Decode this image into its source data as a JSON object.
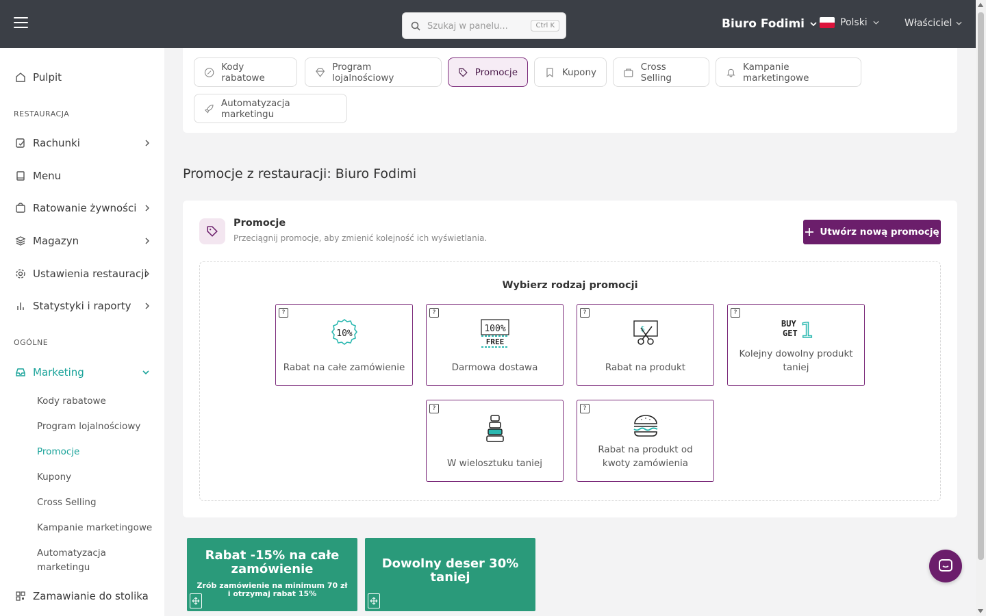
{
  "topbar": {
    "search_placeholder": "Szukaj w panelu...",
    "search_shortcut": "Ctrl K",
    "restaurant": "Biuro Fodimi",
    "language": "Polski",
    "role": "Właściciel"
  },
  "sidebar": {
    "dashboard": "Pulpit",
    "section_restaurant": "RESTAURACJA",
    "bills": "Rachunki",
    "menu": "Menu",
    "food_rescue": "Ratowanie żywności",
    "warehouse": "Magazyn",
    "settings": "Ustawienia restauracji",
    "stats": "Statystyki i raporty",
    "section_general": "OGÓLNE",
    "marketing": "Marketing",
    "sub": [
      "Kody rabatowe",
      "Program lojalnościowy",
      "Promocje",
      "Kupony",
      "Cross Selling",
      "Kampanie marketingowe",
      "Automatyzacja marketingu"
    ],
    "table_ordering": "Zamawianie do stolika"
  },
  "tabs": [
    "Kody rabatowe",
    "Program lojalnościowy",
    "Promocje",
    "Kupony",
    "Cross Selling",
    "Kampanie marketingowe",
    "Automatyzacja marketingu"
  ],
  "page_title": "Promocje z restauracji: Biuro Fodimi",
  "card": {
    "title": "Promocje",
    "subtitle": "Przeciągnij promocje, aby zmienić kolejność ich wyświetlania.",
    "create_button": "Utwórz nową promocję",
    "choose_title": "Wybierz rodzaj promocji",
    "help_glyph": "?",
    "types": [
      "Rabat na całe zamówienie",
      "Darmowa dostawa",
      "Rabat na produkt",
      "Kolejny dowolny produkt taniej",
      "W wielosztuku taniej",
      "Rabat na produkt od kwoty zamówienia"
    ],
    "icon_text": {
      "percent": "10%",
      "free_top": "100%",
      "free_bottom": "FREE",
      "buy": "BUY",
      "get": "GET",
      "one": "1"
    }
  },
  "promos": [
    {
      "title": "Rabat -15% na całe zamówienie",
      "desc": "Zrób zamówienie na minimum 70 zł i otrzymaj rabat 15%"
    },
    {
      "title": "Dowolny deser 30% taniej",
      "desc": ""
    }
  ],
  "colors": {
    "accent": "#6b1e6b",
    "teal": "#1aa39a",
    "promo_green": "#2a9a7a",
    "topbar": "#3b3f46"
  }
}
